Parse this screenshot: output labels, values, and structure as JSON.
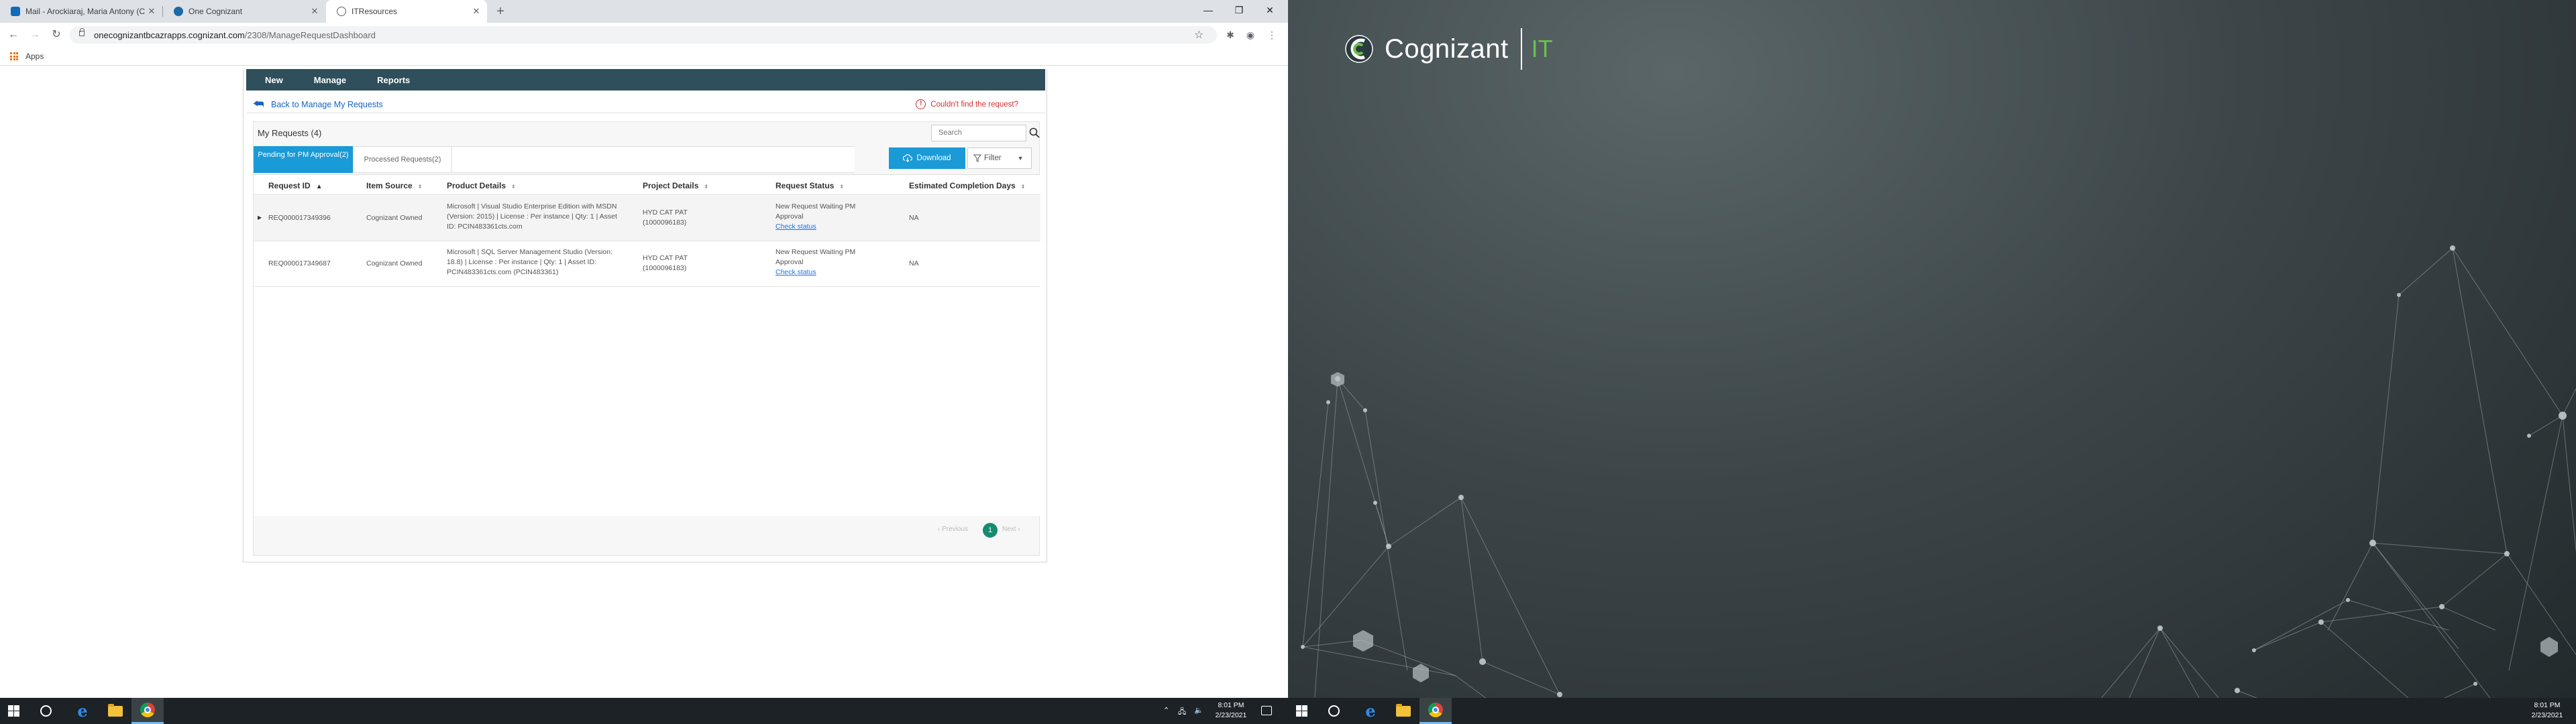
{
  "browser": {
    "tabs": [
      {
        "title": "Mail - Arockiaraj, Maria Antony (C",
        "active": false,
        "favicon_color": "#0f6cbd"
      },
      {
        "title": "One Cognizant",
        "active": false,
        "favicon_color": "#1b6aa5"
      },
      {
        "title": "ITResources",
        "active": true,
        "favicon_color": "#5f6368"
      }
    ],
    "new_tab_label": "+",
    "url_host": "onecognizantbcazrapps.cognizant.com",
    "url_path": "/2308/ManageRequestDashboard",
    "bookmarks": [
      {
        "label": "Apps"
      }
    ]
  },
  "app": {
    "nav": [
      "New",
      "Manage",
      "Reports"
    ],
    "back_link": "Back to Manage My Requests",
    "not_found_link": "Couldn't find the request?",
    "panel_title": "My Requests (4)",
    "search_placeholder": "Search",
    "tabs": {
      "pending": "Pending for PM Approval(2)",
      "processed": "Processed Requests(2)"
    },
    "download_label": "Download",
    "filter_label": "Filter",
    "columns": [
      "Request ID",
      "Item Source",
      "Product Details",
      "Project Details",
      "Request Status",
      "Estimated Completion Days"
    ],
    "rows": [
      {
        "request_id": "REQ000017349396",
        "item_source": "Cognizant Owned",
        "product_details": "Microsoft | Visual Studio Enterprise Edition with MSDN (Version: 2015) | License : Per instance | Qty: 1 | Asset ID: PCIN483361cts.com",
        "project_details": "HYD CAT PAT (1000096183)",
        "request_status": "New Request Waiting PM Approval",
        "status_link": "Check status",
        "completion_days": "NA"
      },
      {
        "request_id": "REQ000017349687",
        "item_source": "Cognizant Owned",
        "product_details": "Microsoft | SQL Server Management Studio (Version: 18.8) | License : Per instance | Qty: 1 | Asset ID: PCIN483361cts.com (PCIN483361)",
        "project_details": "HYD CAT PAT (1000096183)",
        "request_status": "New Request Waiting PM Approval",
        "status_link": "Check status",
        "completion_days": "NA"
      }
    ],
    "pager": {
      "prev": "‹ Previous",
      "current": "1",
      "next": "Next ›"
    }
  },
  "taskbar_left": {
    "time": "8:01 PM",
    "date": "2/23/2021"
  },
  "taskbar_right": {
    "time": "8:01 PM",
    "date": "2/23/2021"
  },
  "desktop": {
    "logo_text": "Cognizant",
    "logo_suffix": "IT"
  },
  "colors": {
    "nav_bg": "#2f4f5c",
    "accent_blue": "#1a9ad6",
    "page_active": "#178a70",
    "error_red": "#d32f2f"
  }
}
